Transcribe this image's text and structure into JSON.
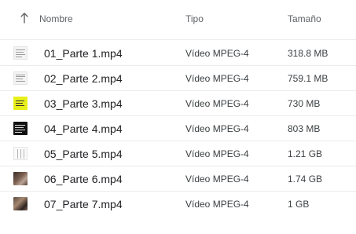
{
  "header": {
    "sort_icon": "arrow-up-icon",
    "name_label": "Nombre",
    "type_label": "Tipo",
    "size_label": "Tamaño"
  },
  "files": [
    {
      "name": "01_Parte 1.mp4",
      "type": "Vídeo MPEG-4",
      "size": "318.8 MB",
      "thumb": "document"
    },
    {
      "name": "02_Parte 2.mp4",
      "type": "Vídeo MPEG-4",
      "size": "759.1 MB",
      "thumb": "document"
    },
    {
      "name": "03_Parte 3.mp4",
      "type": "Vídeo MPEG-4",
      "size": "730 MB",
      "thumb": "yellow-slide"
    },
    {
      "name": "04_Parte 4.mp4",
      "type": "Vídeo MPEG-4",
      "size": "803 MB",
      "thumb": "dark-slide"
    },
    {
      "name": "05_Parte 5.mp4",
      "type": "Vídeo MPEG-4",
      "size": "1.21 GB",
      "thumb": "sheet"
    },
    {
      "name": "06_Parte 6.mp4",
      "type": "Vídeo MPEG-4",
      "size": "1.74 GB",
      "thumb": "photo"
    },
    {
      "name": "07_Parte 7.mp4",
      "type": "Vídeo MPEG-4",
      "size": "1 GB",
      "thumb": "photo"
    }
  ]
}
